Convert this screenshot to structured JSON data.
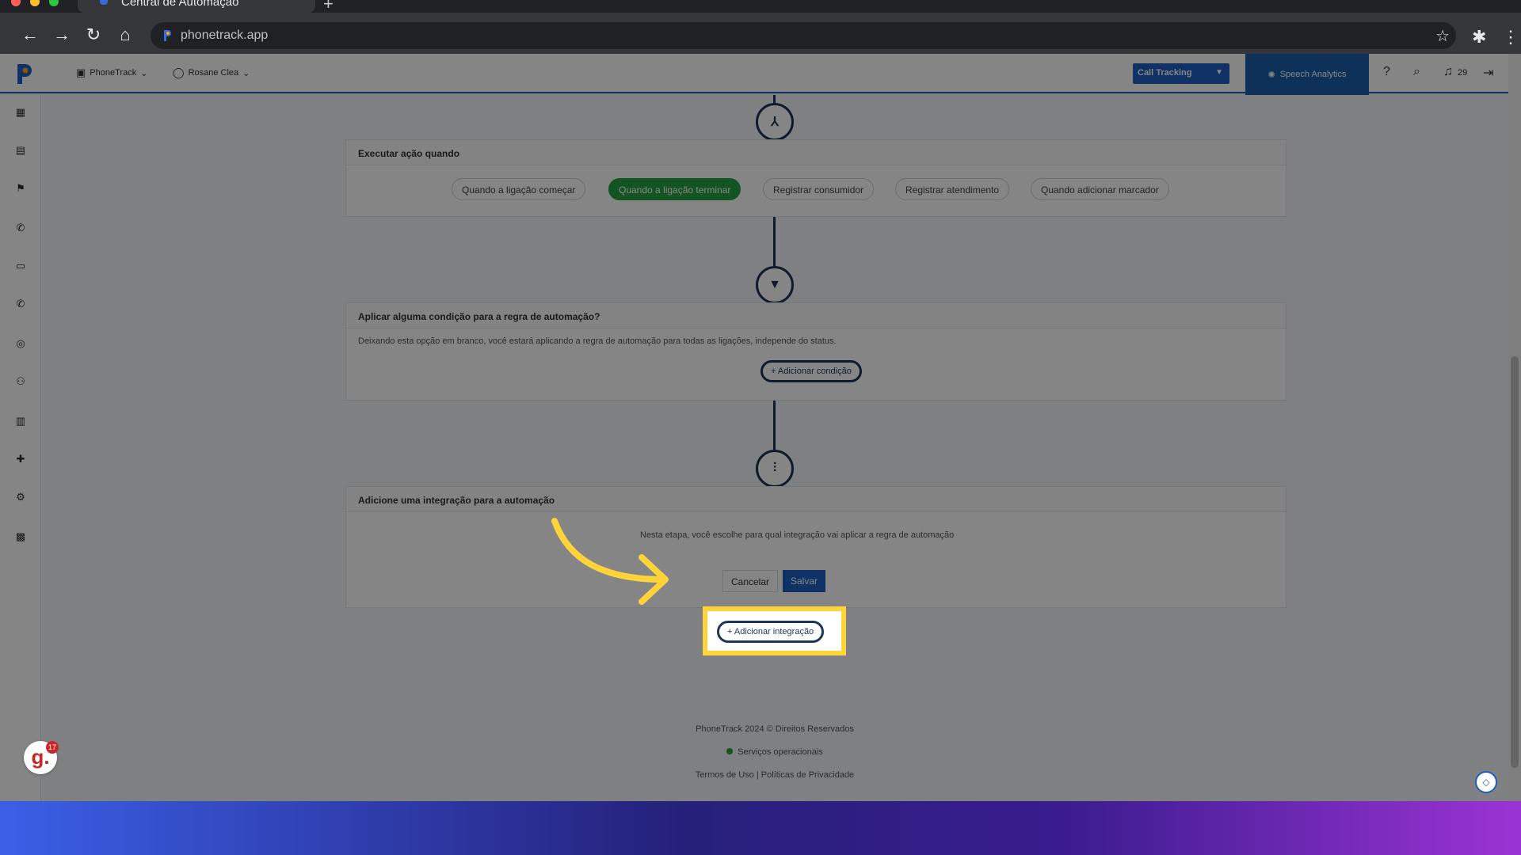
{
  "browser": {
    "tab_title": "Central de Automação",
    "url": "phonetrack.app"
  },
  "header": {
    "account_menu": "PhoneTrack",
    "user_menu": "Rosane Clea",
    "product_select": "Call Tracking",
    "speech_analytics": "Speech Analytics",
    "notifications_count": "29"
  },
  "steps": {
    "trigger": {
      "title": "Executar ação quando",
      "options": [
        "Quando a ligação começar",
        "Quando a ligação terminar",
        "Registrar consumidor",
        "Registrar atendimento",
        "Quando adicionar marcador"
      ],
      "selected_index": 1
    },
    "condition": {
      "title": "Aplicar alguma condição para a regra de automação?",
      "description": "Deixando esta opção em branco, você estará aplicando a regra de automação para todas as ligações, independe do status.",
      "add_button": "Adicionar condição"
    },
    "integration": {
      "title": "Adicione uma integração para a automação",
      "description": "Nesta etapa, você escolhe para qual integração vai aplicar a regra de automação",
      "add_button": "Adicionar integração"
    }
  },
  "actions": {
    "cancel": "Cancelar",
    "save": "Salvar"
  },
  "footer": {
    "copyright": "PhoneTrack 2024 © Direitos Reservados",
    "status": "Serviços operacionais",
    "terms": "Termos de Uso",
    "separator": "|",
    "privacy": "Políticas de Privacidade"
  },
  "widgets": {
    "g_badge": "g.",
    "g_badge_count": "17"
  },
  "colors": {
    "primary": "#1f5fc4",
    "success": "#25a244",
    "node": "#1d3557",
    "highlight": "#ffd43b"
  }
}
